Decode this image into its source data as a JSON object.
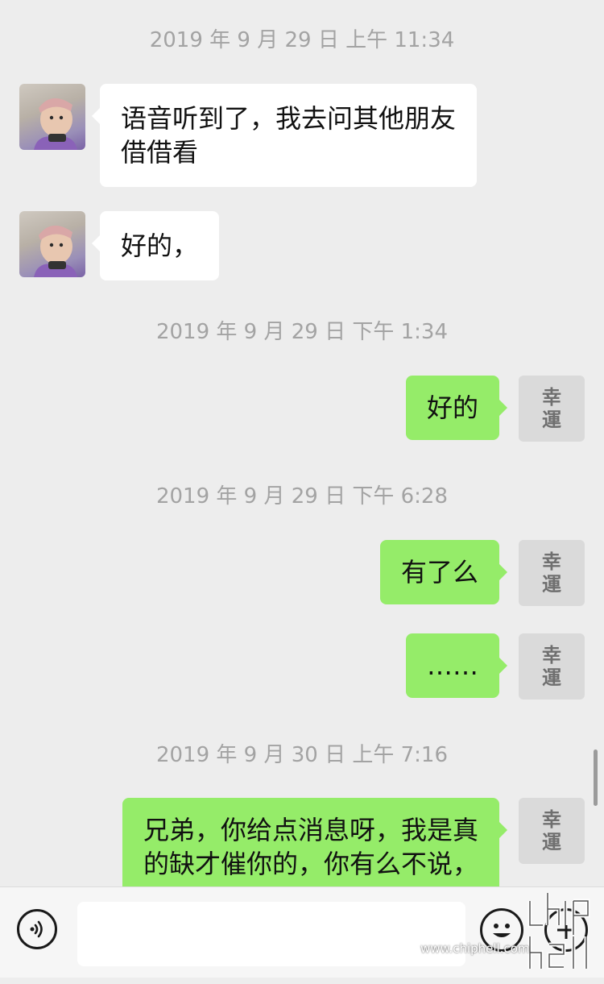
{
  "messages": [
    {
      "kind": "time",
      "text": "2019 年 9 月 29 日 上午 11:34"
    },
    {
      "kind": "in",
      "line1": "语音听到了，我去问其他朋友",
      "line2": "借借看"
    },
    {
      "kind": "in",
      "text": "好的，"
    },
    {
      "kind": "time",
      "text": "2019 年 9 月 29 日 下午 1:34"
    },
    {
      "kind": "out",
      "text": "好的"
    },
    {
      "kind": "time",
      "text": "2019 年 9 月 29 日 下午 6:28"
    },
    {
      "kind": "out",
      "text": "有了么"
    },
    {
      "kind": "out",
      "text": "……"
    },
    {
      "kind": "time",
      "text": "2019 年 9 月 30 日 上午 7:16"
    },
    {
      "kind": "out",
      "line1": "兄弟，你给点消息呀，我是真",
      "line2": "的缺才催你的，你有么不说，"
    }
  ],
  "self_avatar": {
    "char1": "幸",
    "char2": "運"
  },
  "input_bar": {
    "voice_icon": "voice-icon",
    "emoji_icon": "emoji-icon",
    "plus_icon": "plus-icon",
    "placeholder": ""
  },
  "watermark": {
    "logo": "chip hell",
    "url": "www.chiphell.com"
  },
  "colors": {
    "background": "#ededed",
    "outgoing_bubble": "#95ec69",
    "incoming_bubble": "#ffffff",
    "timestamp": "#a3a3a3"
  }
}
